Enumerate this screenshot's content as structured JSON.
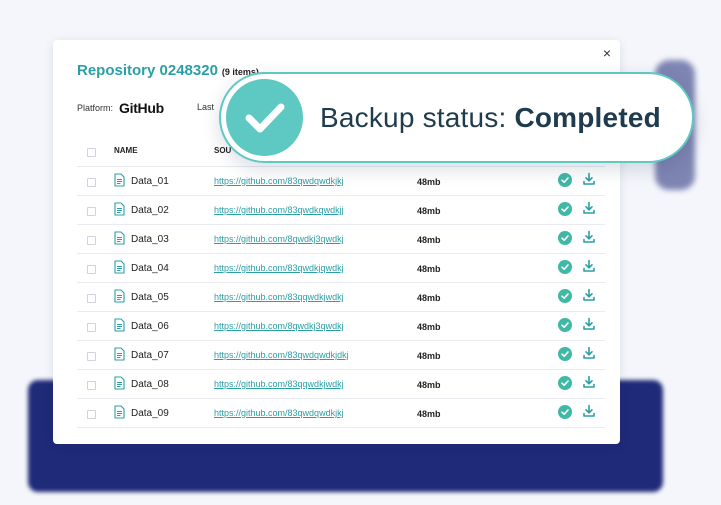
{
  "modal": {
    "title": "Repository 0248320",
    "count": "(9 items)",
    "close_glyph": "×",
    "platform_label": "Platform:",
    "platform_name": "GitHub",
    "last_label": "Last"
  },
  "table": {
    "header_name": "NAME",
    "header_source": "SOU",
    "rows": [
      {
        "name": "Data_01",
        "url": "https://github.com/83qwdqwdkjkj",
        "size": "48mb",
        "status_icon": "check-circle-icon",
        "action_icon": "download-icon"
      },
      {
        "name": "Data_02",
        "url": "https://github.com/83qwdkqwdkjj",
        "size": "48mb",
        "status_icon": "check-circle-icon",
        "action_icon": "download-icon"
      },
      {
        "name": "Data_03",
        "url": "https://github.com/8qwdkj3qwdkj",
        "size": "48mb",
        "status_icon": "check-circle-icon",
        "action_icon": "download-icon"
      },
      {
        "name": "Data_04",
        "url": "https://github.com/83qwdkjqwdkj",
        "size": "48mb",
        "status_icon": "check-circle-icon",
        "action_icon": "download-icon"
      },
      {
        "name": "Data_05",
        "url": "https://github.com/83qqwdkjwdkj",
        "size": "48mb",
        "status_icon": "check-circle-icon",
        "action_icon": "download-icon"
      },
      {
        "name": "Data_06",
        "url": "https://github.com/8qwdkj3qwdkj",
        "size": "48mb",
        "status_icon": "check-circle-icon",
        "action_icon": "download-icon"
      },
      {
        "name": "Data_07",
        "url": "https://github.com/83qwdqwdkjdkj",
        "size": "48mb",
        "status_icon": "check-circle-icon",
        "action_icon": "download-icon"
      },
      {
        "name": "Data_08",
        "url": "https://github.com/83qqwdkjwdkj",
        "size": "48mb",
        "status_icon": "check-circle-icon",
        "action_icon": "download-icon"
      },
      {
        "name": "Data_09",
        "url": "https://github.com/83qwdqwdkjkj",
        "size": "48mb",
        "status_icon": "check-circle-icon",
        "action_icon": "download-icon"
      }
    ]
  },
  "toast": {
    "prefix": "Backup status: ",
    "status": "Completed"
  },
  "colors": {
    "accent": "#2a9fa6",
    "toast_green": "#5ec8c3",
    "check_green": "#3fb8a6",
    "backdrop_navy": "#1f2a78",
    "text_dark": "#1f3b4d"
  }
}
